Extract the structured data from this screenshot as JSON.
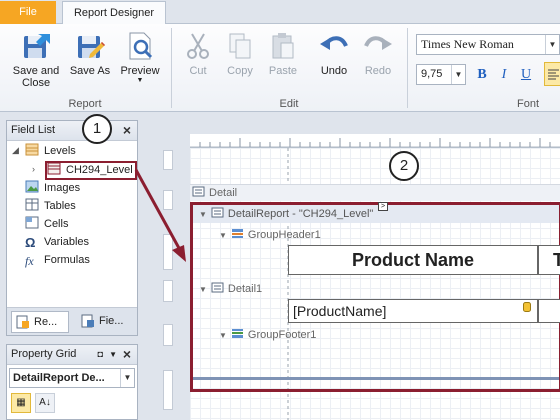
{
  "ribbon_tabs": {
    "file": "File",
    "report_designer": "Report Designer"
  },
  "report_group": {
    "label": "Report",
    "save_and_close": "Save and Close",
    "save_as": "Save As",
    "preview": "Preview"
  },
  "edit_group": {
    "label": "Edit",
    "cut": "Cut",
    "copy": "Copy",
    "paste": "Paste",
    "undo": "Undo",
    "redo": "Redo"
  },
  "font_group": {
    "label": "Font",
    "font_name": "Times New Roman",
    "font_size": "9,75",
    "bold": "B",
    "italic": "I",
    "underline": "U"
  },
  "field_list": {
    "title": "Field List",
    "items": [
      {
        "label": "Levels",
        "icon": "database-icon"
      },
      {
        "label": "CH294_Level",
        "icon": "table-icon"
      },
      {
        "label": "Images",
        "icon": "image-icon"
      },
      {
        "label": "Tables",
        "icon": "table-icon"
      },
      {
        "label": "Cells",
        "icon": "cell-icon"
      },
      {
        "label": "Variables",
        "icon": "omega-icon"
      },
      {
        "label": "Formulas",
        "icon": "fx-icon"
      }
    ],
    "variables_glyph": "Ω",
    "formulas_glyph": "fx",
    "tabs": [
      "Re...",
      "Fie..."
    ]
  },
  "property_grid": {
    "title": "Property Grid",
    "selected": "DetailReport  De..."
  },
  "designer": {
    "bands": {
      "detail": "Detail",
      "detail_report": "DetailReport - \"CH294_Level\"",
      "group_header": "GroupHeader1",
      "detail1": "Detail1",
      "group_footer": "GroupFooter1"
    },
    "header_cell": "Product Name",
    "header_cell_next": "T",
    "data_cell": "[ProductName]"
  },
  "callouts": [
    "1",
    "2"
  ],
  "colors": {
    "highlight": "#8b1e30",
    "file_tab": "#f6a623",
    "accent": "#1f5fbf"
  }
}
